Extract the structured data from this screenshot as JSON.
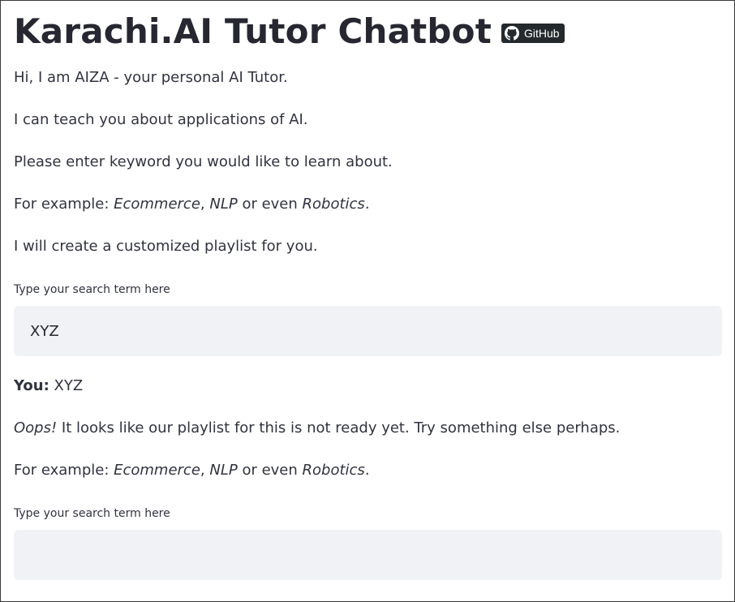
{
  "header": {
    "title": "Karachi.AI Tutor Chatbot",
    "github_badge": {
      "label": "GitHub",
      "icon": "github-icon"
    }
  },
  "intro": {
    "line1": "Hi, I am AIZA - your personal AI Tutor.",
    "line2": "I can teach you about applications of AI.",
    "line3": "Please enter keyword you would like to learn about.",
    "example": {
      "prefix": "For example: ",
      "item1": "Ecommerce",
      "sep": ", ",
      "item2": "NLP",
      "mid": " or even ",
      "item3": "Robotics",
      "suffix": "."
    },
    "line5": "I will create a customized playlist for you."
  },
  "search1": {
    "label": "Type your search term here",
    "value": "XYZ"
  },
  "chat": {
    "you_label": "You:",
    "you_text": " XYZ",
    "oops": "Oops!",
    "oops_text": " It looks like our playlist for this is not ready yet. Try something else perhaps.",
    "example": {
      "prefix": "For example: ",
      "item1": "Ecommerce",
      "sep": ", ",
      "item2": "NLP",
      "mid": " or even ",
      "item3": "Robotics",
      "suffix": "."
    }
  },
  "search2": {
    "label": "Type your search term here",
    "value": ""
  },
  "colors": {
    "text": "#31333f",
    "input_bg": "#f0f2f6",
    "badge_bg": "#24292e"
  }
}
